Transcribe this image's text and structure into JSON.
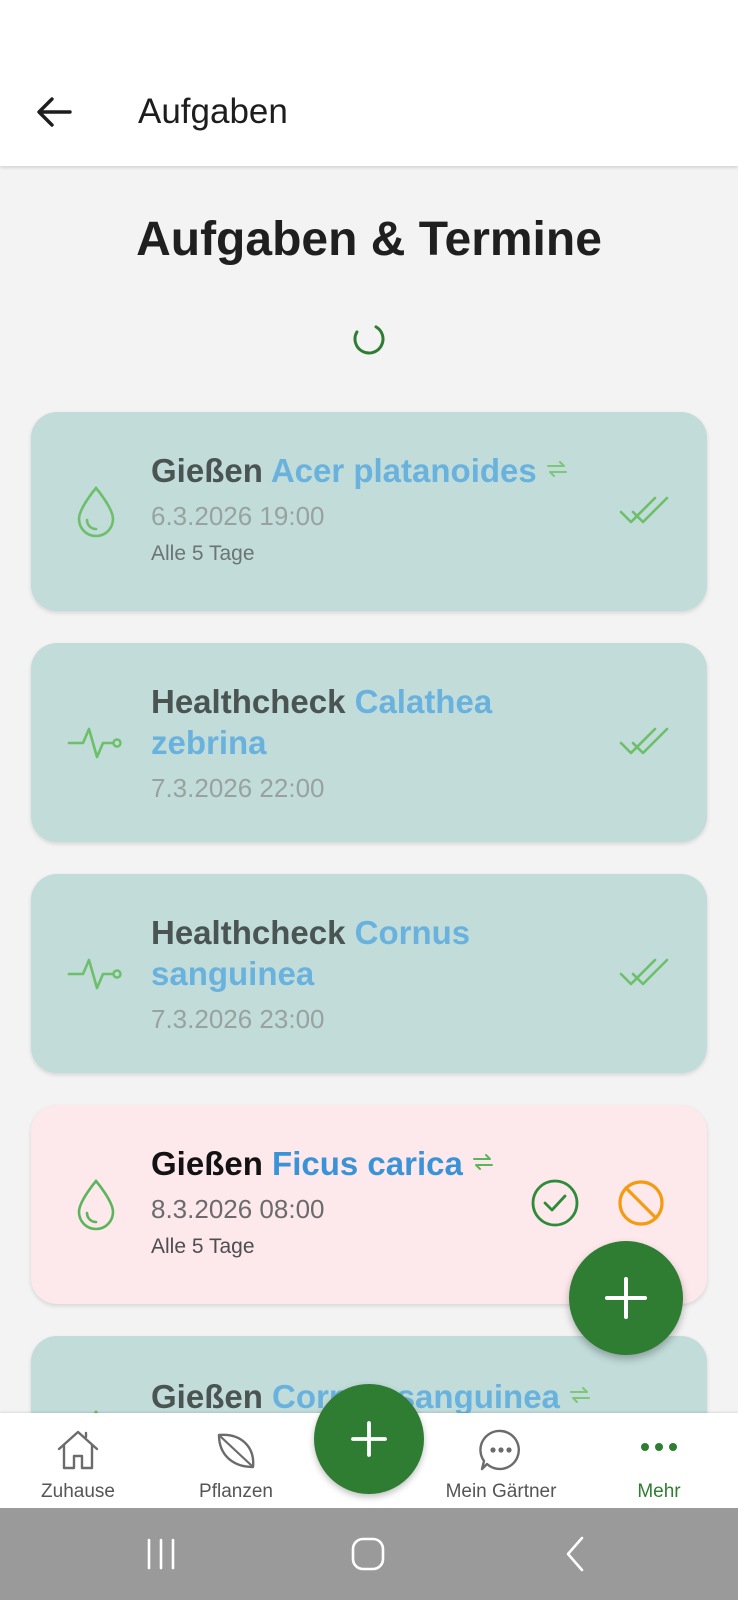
{
  "app_bar": {
    "title": "Aufgaben",
    "back_icon": "arrow-left-icon"
  },
  "page": {
    "heading": "Aufgaben & Termine"
  },
  "colors": {
    "primary": "#2e7d32",
    "done_card": "#c1dcd9",
    "open_card": "#fde8ec",
    "link_blue": "#3a93d6",
    "skip_orange": "#f39c12"
  },
  "tasks": [
    {
      "type": "Gießen",
      "plant": "Acer platanoides",
      "repeating": true,
      "date": "6.3.2026 19:00",
      "frequency": "Alle 5 Tage",
      "status": "done",
      "icon": "water-drop-icon"
    },
    {
      "type": "Healthcheck",
      "plant": "Calathea zebrina",
      "repeating": false,
      "date": "7.3.2026 22:00",
      "status": "done",
      "icon": "heartbeat-icon"
    },
    {
      "type": "Healthcheck",
      "plant": "Cornus sanguinea",
      "repeating": false,
      "date": "7.3.2026 23:00",
      "status": "done",
      "icon": "heartbeat-icon"
    },
    {
      "type": "Gießen",
      "plant": "Ficus carica",
      "repeating": true,
      "date": "8.3.2026 08:00",
      "frequency": "Alle 5 Tage",
      "status": "open",
      "icon": "water-drop-icon"
    },
    {
      "type": "Gießen",
      "plant": "Cornus sanguinea",
      "repeating": true,
      "status": "done",
      "icon": "water-drop-icon"
    }
  ],
  "bottom_nav": [
    {
      "label": "Zuhause",
      "icon": "home-icon"
    },
    {
      "label": "Pflanzen",
      "icon": "leaf-icon"
    },
    {
      "label": "Mein Gärtner",
      "icon": "chat-icon"
    },
    {
      "label": "Mehr",
      "icon": "more-dots-icon",
      "active": true
    }
  ]
}
